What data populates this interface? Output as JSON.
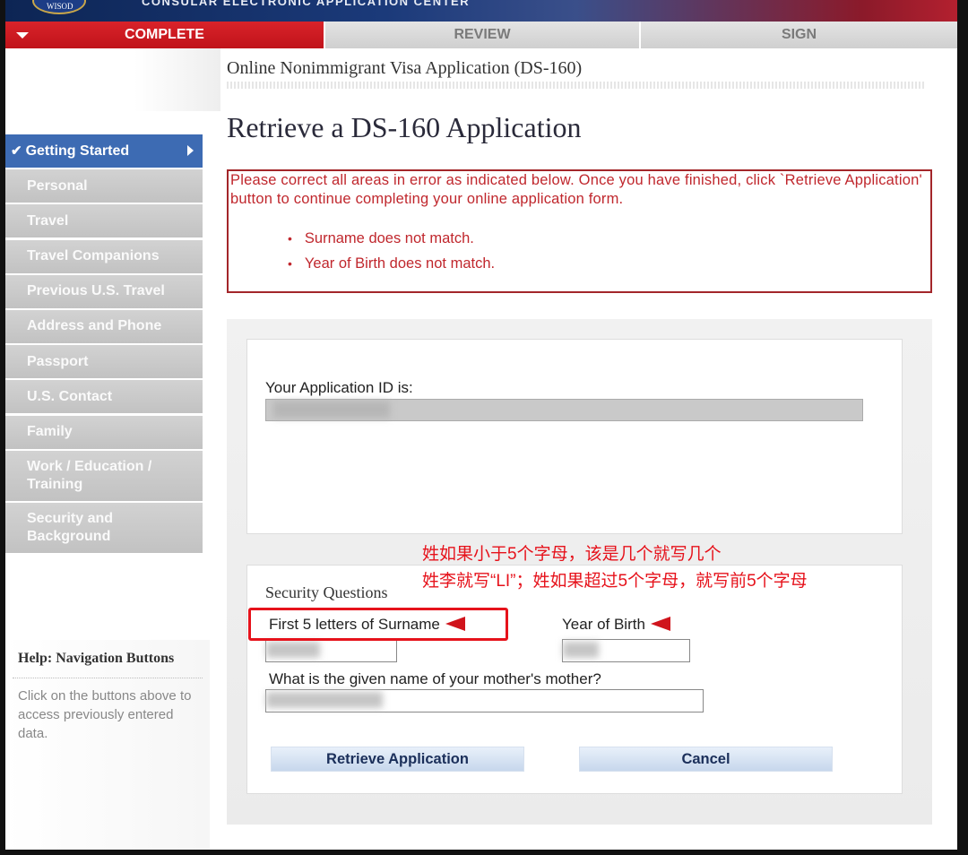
{
  "banner": {
    "seal_text": "WISOD",
    "center_title": "CONSULAR ELECTRONIC APPLICATION CENTER"
  },
  "steps": {
    "complete": "COMPLETE",
    "review": "REVIEW",
    "sign": "SIGN"
  },
  "sidebar": {
    "items": [
      {
        "label": "Getting Started"
      },
      {
        "label": "Personal"
      },
      {
        "label": "Travel"
      },
      {
        "label": "Travel Companions"
      },
      {
        "label": "Previous U.S. Travel"
      },
      {
        "label": "Address and Phone"
      },
      {
        "label": "Passport"
      },
      {
        "label": "U.S. Contact"
      },
      {
        "label": "Family"
      },
      {
        "label": "Work / Education / Training"
      },
      {
        "label": "Security and Background"
      }
    ]
  },
  "help": {
    "title_bold": "Help:",
    "title_rest": "Navigation Buttons",
    "text": "Click on the buttons above to access previously entered data."
  },
  "main": {
    "app_title": "Online Nonimmigrant Visa Application (DS-160)",
    "page_title": "Retrieve a DS-160 Application",
    "error_message": "Please correct all areas in error as indicated below. Once you have finished, click `Retrieve Application' button to continue completing your online application form.",
    "errors": [
      "Surname does not match.",
      "Year of Birth does not match."
    ],
    "app_id_label": "Your Application ID is:",
    "security_questions_label": "Security Questions",
    "surname_label": "First 5 letters of Surname",
    "yob_label": "Year of Birth",
    "mother_question": "What is the given name of your mother's mother?",
    "retrieve_button": "Retrieve Application",
    "cancel_button": "Cancel"
  },
  "annotation": {
    "line1": "姓如果小于5个字母，该是几个就写几个",
    "line2": "姓李就写“LI”；姓如果超过5个字母，就写前5个字母",
    "color": "#e6121b"
  }
}
